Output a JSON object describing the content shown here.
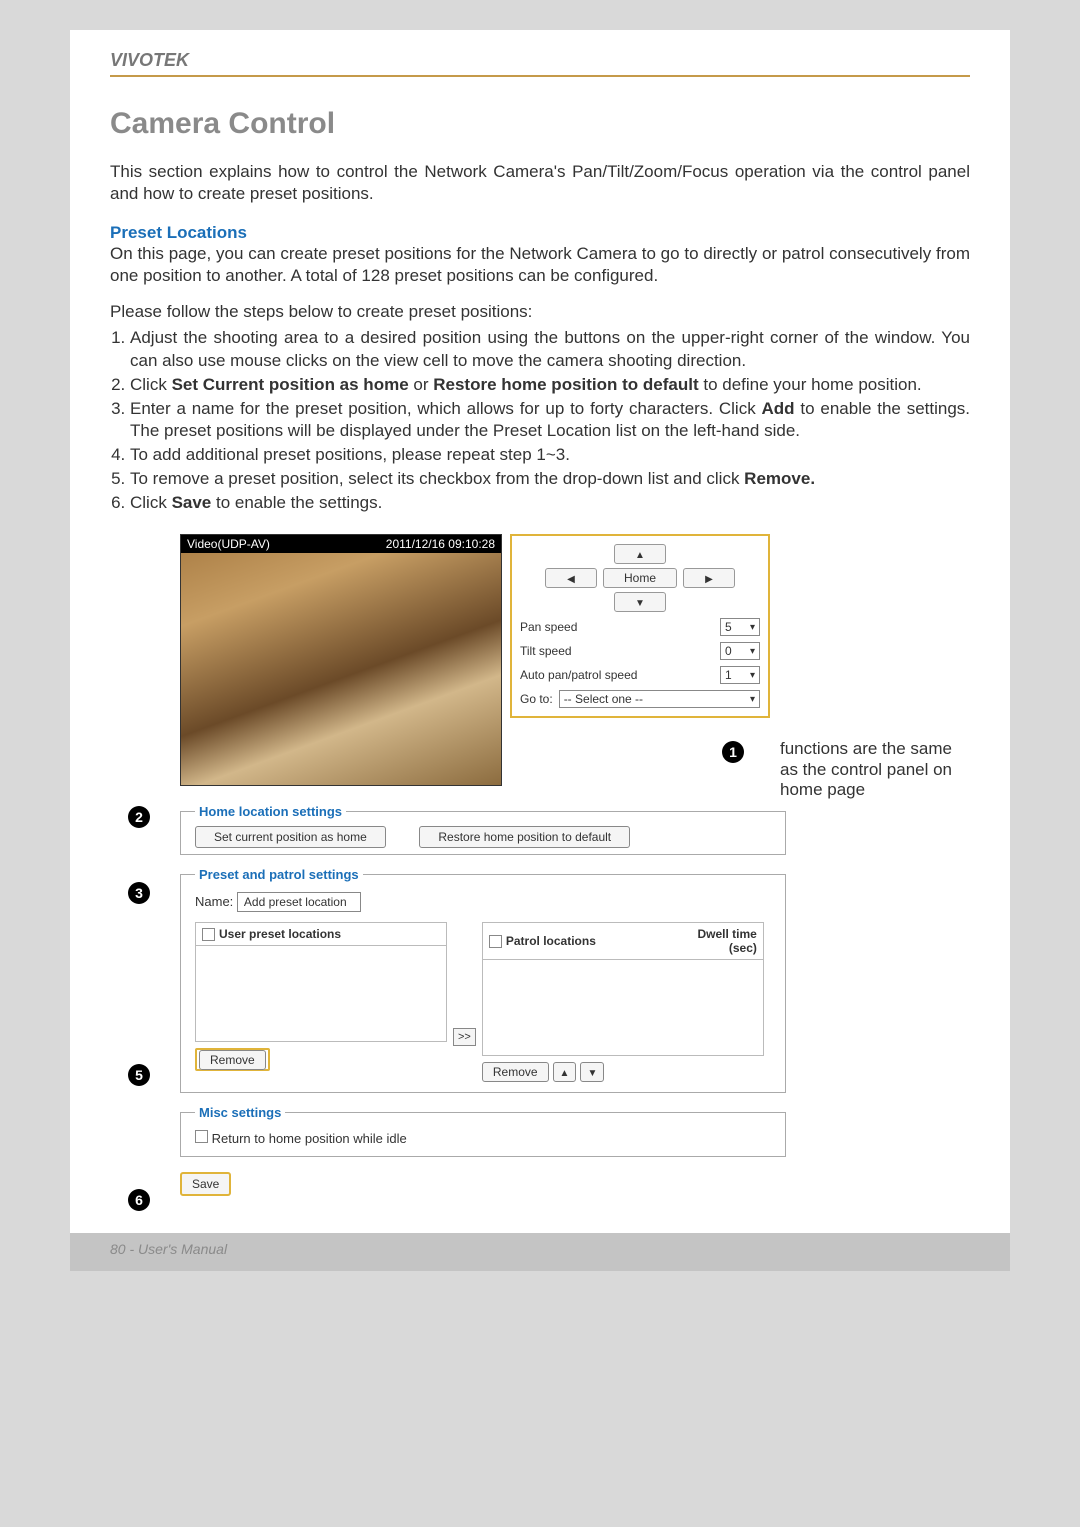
{
  "brand": "VIVOTEK",
  "title": "Camera Control",
  "intro": "This section explains how to control the Network Camera's Pan/Tilt/Zoom/Focus operation via the control panel and how to create preset positions.",
  "preset": {
    "heading": "Preset Locations",
    "p1": "On this page, you can create preset positions for the Network Camera to go to directly or patrol consecutively from one position to another. A total of 128 preset positions can be configured.",
    "p2": "Please follow the steps below to create preset positions:"
  },
  "steps": {
    "s1": "Adjust the shooting area to a desired position using the buttons on the upper-right corner of the window. You can also use mouse clicks on the view cell to move the camera shooting direction.",
    "s2a": "Click ",
    "s2b1": "Set Current position as home",
    "s2c": " or ",
    "s2b2": "Restore home position to default",
    "s2d": " to define your home position.",
    "s3a": "Enter a name for the preset position, which allows for up to forty characters. Click ",
    "s3b": "Add",
    "s3c": " to enable the settings. The preset positions will be displayed under the Preset Location list on the left-hand side.",
    "s4": "To add additional preset positions, please repeat step 1~3.",
    "s5a": "To remove a preset position, select its checkbox from the drop-down list and click ",
    "s5b": "Remove.",
    "s6a": "Click ",
    "s6b": "Save",
    "s6c": " to enable the settings."
  },
  "video": {
    "label": "Video(UDP-AV)",
    "timestamp": "2011/12/16 09:10:28"
  },
  "controls": {
    "home": "Home",
    "pan_speed_label": "Pan speed",
    "pan_speed_value": "5",
    "tilt_speed_label": "Tilt speed",
    "tilt_speed_value": "0",
    "auto_speed_label": "Auto pan/patrol speed",
    "auto_speed_value": "1",
    "goto_label": "Go to:",
    "goto_value": "-- Select one --"
  },
  "annotation_note": "functions are the same as the control panel on  home page",
  "num1": "1",
  "num2": "2",
  "num3": "3",
  "num5": "5",
  "num6": "6",
  "fieldset1": {
    "legend": "Home location settings",
    "btn1": "Set current position as home",
    "btn2": "Restore home position to default"
  },
  "fieldset2": {
    "legend": "Preset and patrol settings",
    "name_label": "Name:",
    "name_placeholder": "Add preset location",
    "user_list": "User preset locations",
    "patrol_list": "Patrol locations",
    "dwell": "Dwell time (sec)",
    "remove": "Remove",
    "move": ">>"
  },
  "fieldset3": {
    "legend": "Misc settings",
    "return_idle": "Return to home position while idle"
  },
  "save_btn": "Save",
  "footer": "80 - User's Manual"
}
